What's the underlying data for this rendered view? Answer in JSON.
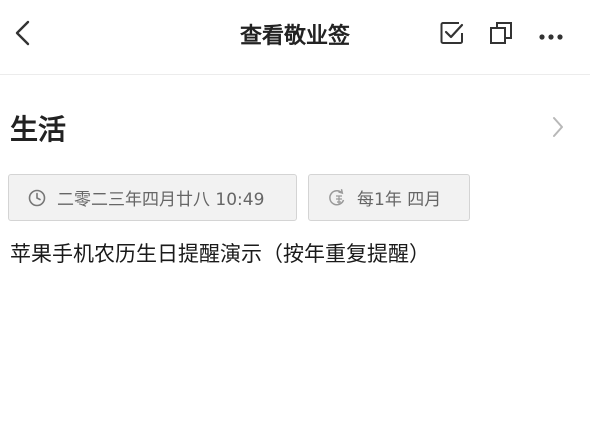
{
  "header": {
    "title": "查看敬业签",
    "back_icon": "chevron-left-icon",
    "actions": [
      "check-square-icon",
      "copy-icon",
      "more-horizontal-icon"
    ]
  },
  "note": {
    "category": "生活",
    "datetime": "二零二三年四月廿八 10:49",
    "repeat": "每1年 四月",
    "content": "苹果手机农历生日提醒演示（按年重复提醒）"
  },
  "colors": {
    "background": "#ffffff",
    "chip_background": "#f2f2f2",
    "chip_border": "#d4d4d4",
    "icon": "#333333",
    "muted_icon": "#9a9a9a",
    "chip_text": "#666666"
  }
}
